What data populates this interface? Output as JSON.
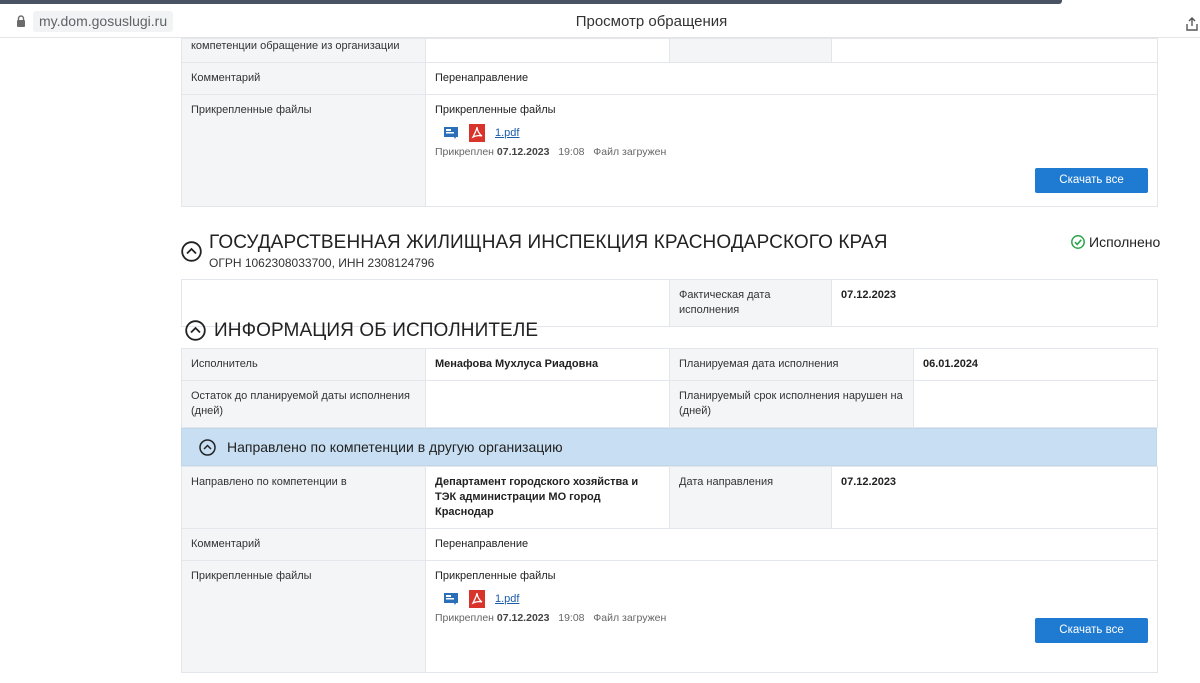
{
  "browser": {
    "url": "my.dom.gosuslugi.ru",
    "title": "Просмотр обращения"
  },
  "top_block": {
    "cut_label": "компетенции обращение из организации",
    "comment_label": "Комментарий",
    "comment_value": "Перенаправление",
    "files_label": "Прикрепленные файлы",
    "files_caption": "Прикрепленные файлы",
    "file_name": "1.pdf",
    "attached_prefix": "Прикреплен",
    "attached_date": "07.12.2023",
    "attached_time": "19:08",
    "attached_status": "Файл загружен",
    "download_all": "Скачать все"
  },
  "organization": {
    "name": "ГОСУДАРСТВЕННАЯ ЖИЛИЩНАЯ ИНСПЕКЦИЯ КРАСНОДАРСКОГО КРАЯ",
    "ids": "ОГРН 1062308033700, ИНН 2308124796",
    "status": "Исполнено",
    "actual_date_label": "Фактическая дата исполнения",
    "actual_date_value": "07.12.2023"
  },
  "executor_section": {
    "title": "ИНФОРМАЦИЯ ОБ ИСПОЛНИТЕЛЕ",
    "executor_label": "Исполнитель",
    "executor_value": "Менафова Мухлуса Риадовна",
    "planned_date_label": "Планируемая дата исполнения",
    "planned_date_value": "06.01.2024",
    "remaining_label": "Остаток до планируемой даты исполнения (дней)",
    "remaining_value": "",
    "violated_label": "Планируемый срок исполнения нарушен на (дней)",
    "violated_value": ""
  },
  "redirect_section": {
    "title": "Направлено по компетенции в другую организацию",
    "sent_to_label": "Направлено по компетенции в",
    "sent_to_value": "Департамент городского хозяйства и ТЭК администрации МО город Краснодар",
    "sent_date_label": "Дата направления",
    "sent_date_value": "07.12.2023",
    "comment_label": "Комментарий",
    "comment_value": "Перенаправление",
    "files_label": "Прикрепленные файлы",
    "files_caption": "Прикрепленные файлы",
    "file_name": "1.pdf",
    "attached_prefix": "Прикреплен",
    "attached_date": "07.12.2023",
    "attached_time": "19:08",
    "attached_status": "Файл загружен",
    "download_all": "Скачать все"
  },
  "colors": {
    "button": "#1f7bd1",
    "band": "#c8dff3",
    "label_bg": "#f3f5f7",
    "link": "#1a5ca8",
    "status_ok": "#2aa34a"
  },
  "icons": [
    "lock-icon",
    "share-icon",
    "signature-icon",
    "pdf-icon",
    "chevron-up-circle-icon",
    "check-circle-icon"
  ]
}
